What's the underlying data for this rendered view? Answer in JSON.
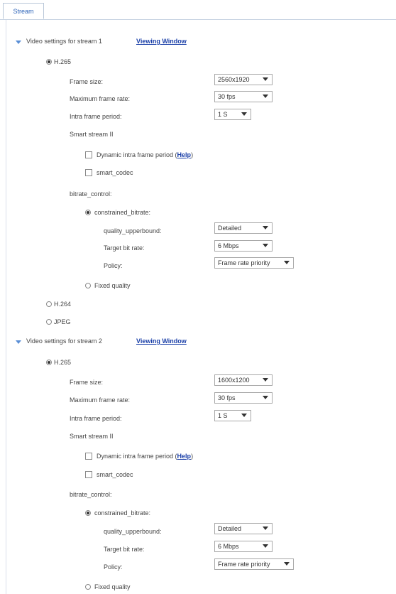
{
  "tab": {
    "label": "Stream"
  },
  "streams": [
    {
      "title": "Video settings for stream 1",
      "viewing_window": "Viewing Window",
      "codec_h265": "H.265",
      "frame_size_label": "Frame size:",
      "frame_size": "2560x1920",
      "max_frame_rate_label": "Maximum frame rate:",
      "max_frame_rate": "30 fps",
      "intra_frame_label": "Intra frame period:",
      "intra_frame": "1 S",
      "smart_stream": "Smart stream II",
      "dynamic_intra": "Dynamic intra frame period (",
      "help": "Help",
      "dynamic_close": ")",
      "smart_codec": "smart_codec",
      "bitrate_control": "bitrate_control:",
      "constrained": "constrained_bitrate:",
      "quality_label": "quality_upperbound:",
      "quality": "Detailed",
      "target_label": "Target bit rate:",
      "target": "6 Mbps",
      "policy_label": "Policy:",
      "policy": "Frame rate priority",
      "fixed": "Fixed quality"
    },
    {
      "title": "Video settings for stream 2",
      "viewing_window": "Viewing Window",
      "codec_h265": "H.265",
      "frame_size_label": "Frame size:",
      "frame_size": "1600x1200",
      "max_frame_rate_label": "Maximum frame rate:",
      "max_frame_rate": "30 fps",
      "intra_frame_label": "Intra frame period:",
      "intra_frame": "1 S",
      "smart_stream": "Smart stream II",
      "dynamic_intra": "Dynamic intra frame period (",
      "help": "Help",
      "dynamic_close": ")",
      "smart_codec": "smart_codec",
      "bitrate_control": "bitrate_control:",
      "constrained": "constrained_bitrate:",
      "quality_label": "quality_upperbound:",
      "quality": "Detailed",
      "target_label": "Target bit rate:",
      "target": "6 Mbps",
      "policy_label": "Policy:",
      "policy": "Frame rate priority",
      "fixed": "Fixed quality"
    }
  ],
  "codec_h264": "H.264",
  "codec_jpeg": "JPEG"
}
